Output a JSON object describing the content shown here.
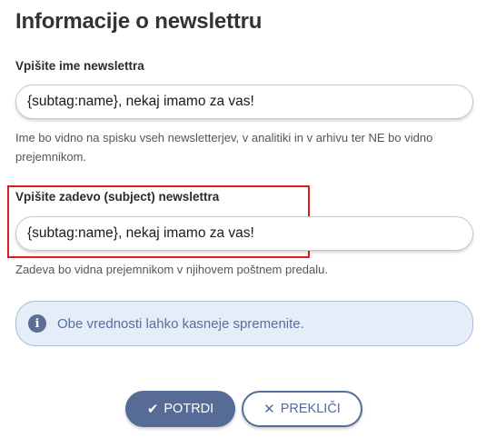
{
  "form": {
    "title": "Informacije o newslettru",
    "name_label": "Vpišite ime newslettra",
    "name_value": "{subtag:name}, nekaj imamo za vas!",
    "name_help": "Ime bo vidno na spisku vseh newsletterjev, v analitiki in v arhivu ter NE bo vidno prejemnikom.",
    "subject_label": "Vpišite zadevo (subject) newslettra",
    "subject_value": "{subtag:name}, nekaj imamo za vas!",
    "subject_help": "Zadeva bo vidna prejemnikom v njihovem poštnem predalu."
  },
  "info": {
    "icon": "info-icon",
    "text": "Obe vrednosti lahko kasneje spremenite."
  },
  "buttons": {
    "confirm_label": "POTRDI",
    "confirm_icon": "check-icon",
    "cancel_label": "PREKLIČI",
    "cancel_icon": "close-icon"
  },
  "colors": {
    "accent": "#566c97",
    "highlight": "#e01b1b",
    "info_background": "#e5edf8"
  }
}
